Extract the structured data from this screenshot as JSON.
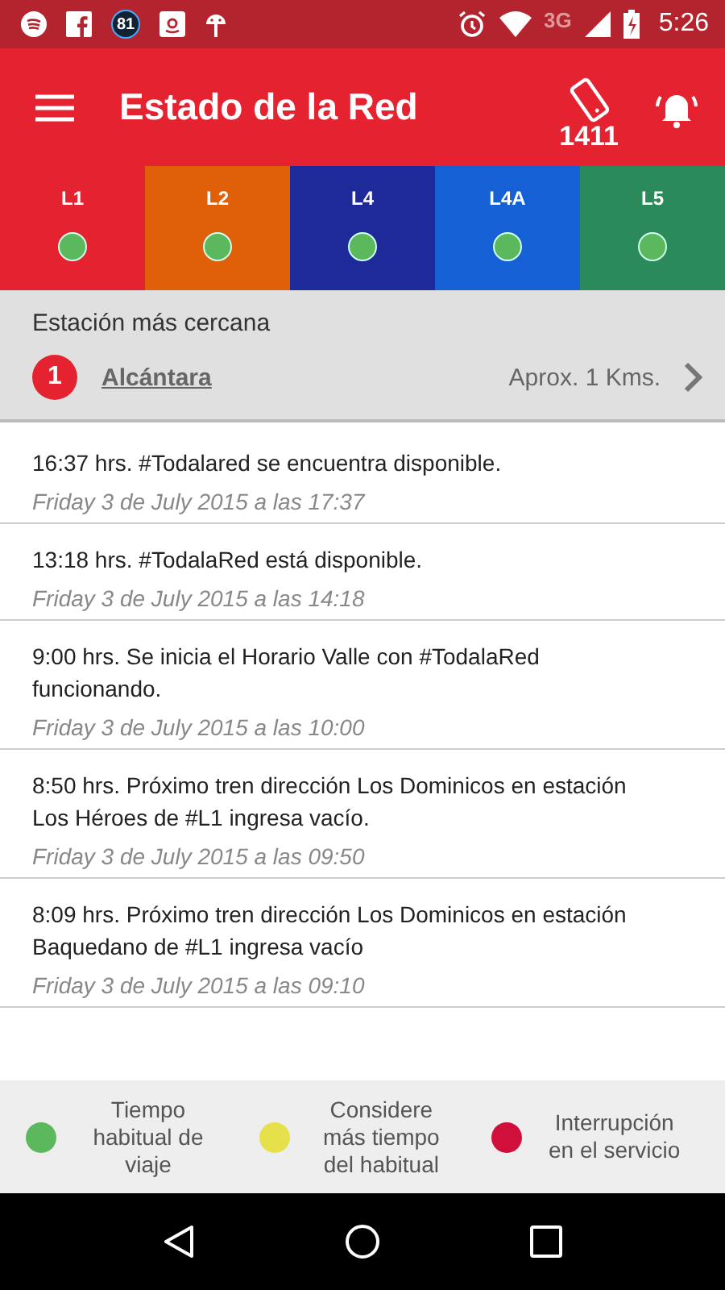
{
  "status_bar": {
    "badge": "81",
    "network": "3G",
    "time": "5:26"
  },
  "app_bar": {
    "title": "Estado de la Red",
    "phone_number": "1411"
  },
  "lines": [
    {
      "label": "L1",
      "color": "#e52330",
      "interrupted": false
    },
    {
      "label": "L2",
      "color": "#e0600a",
      "interrupted": false
    },
    {
      "label": "L4",
      "color": "#1f2a9a",
      "interrupted": false
    },
    {
      "label": "L4A",
      "color": "#1560d4",
      "interrupted": false
    },
    {
      "label": "L5",
      "color": "#2a8a5a",
      "interrupted": false
    }
  ],
  "nearest_station": {
    "heading": "Estación más cercana",
    "line_number": "1",
    "name": "Alcántara",
    "distance": "Aprox. 1 Kms."
  },
  "feed": [
    {
      "text": "16:37 hrs. #Todalared se encuentra disponible.",
      "date": "Friday 3 de July 2015 a las 17:37"
    },
    {
      "text": "13:18 hrs. #TodalaRed está disponible.",
      "date": "Friday 3 de July 2015 a las 14:18"
    },
    {
      "text": "9:00 hrs. Se inicia el Horario Valle con #TodalaRed funcionando.",
      "date": "Friday 3 de July 2015 a las 10:00"
    },
    {
      "text": "8:50 hrs. Próximo tren dirección Los Dominicos en estación Los Héroes de #L1 ingresa vacío.",
      "date": "Friday 3 de July 2015 a las 09:50"
    },
    {
      "text": "8:09 hrs. Próximo tren dirección Los Dominicos en estación Baquedano de #L1 ingresa vacío",
      "date": "Friday 3 de July 2015 a las 09:10"
    }
  ],
  "legend": [
    {
      "label": "Tiempo habitual de viaje",
      "color": "#5cb85c"
    },
    {
      "label": "Considere más tiempo del habitual",
      "color": "#e6e04a"
    },
    {
      "label": "Interrupción en el servicio",
      "color": "#d0103a"
    }
  ]
}
